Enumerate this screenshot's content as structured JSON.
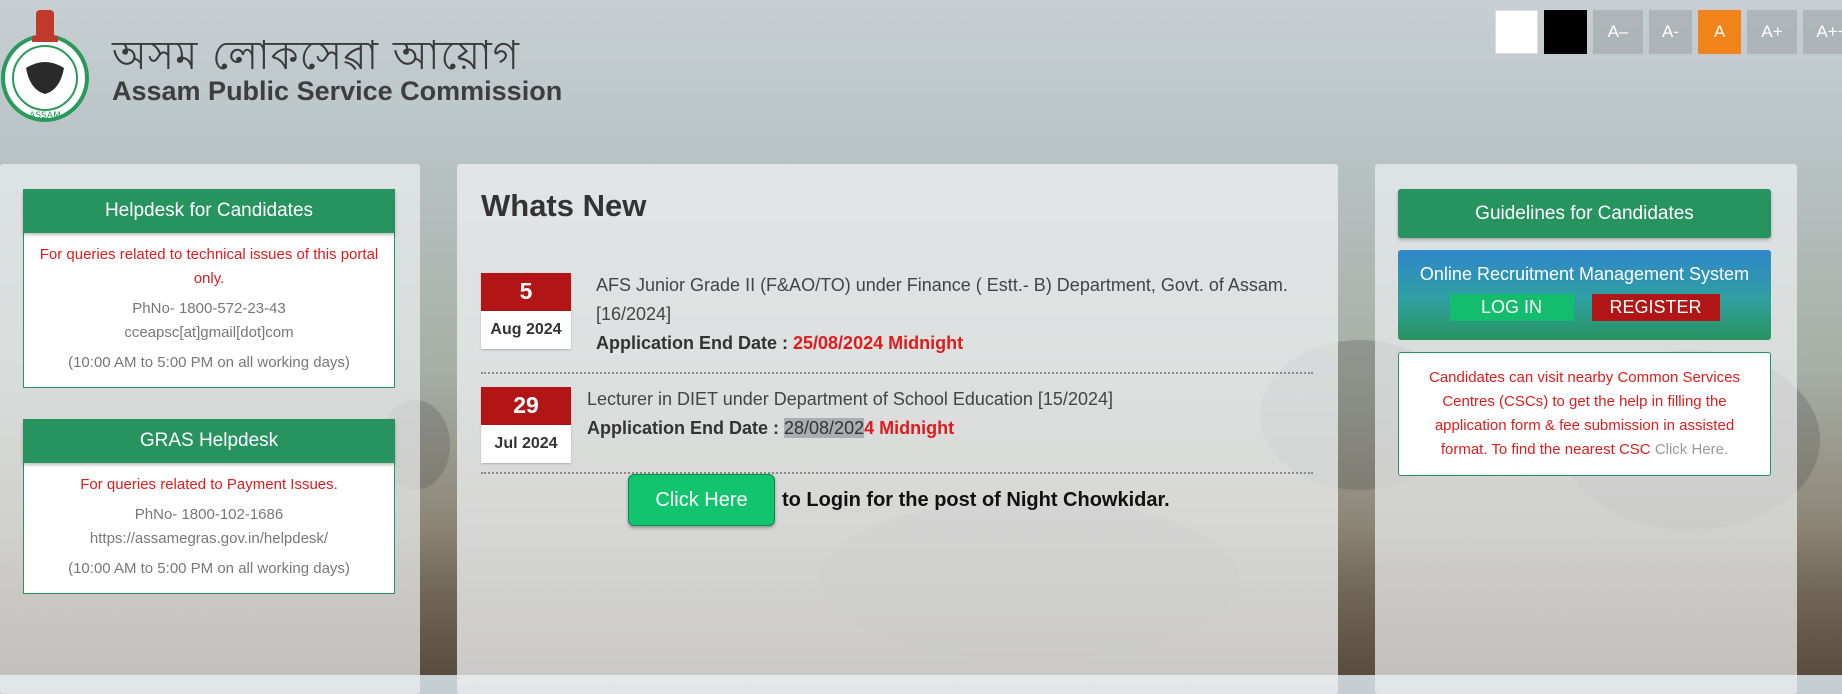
{
  "header": {
    "title_bn": "অসম লোকসেৱা আয়োগ",
    "title_en": "Assam Public Service Commission",
    "emblem_label": "ASSAM"
  },
  "font_tools": [
    "",
    "",
    "A–",
    "A-",
    "A",
    "A+",
    "A++"
  ],
  "helpdesk": {
    "title": "Helpdesk for Candidates",
    "note": "For queries related to technical issues of this portal only.",
    "phone": "PhNo- 1800-572-23-43",
    "email": "cceapsc[at]gmail[dot]com",
    "hours": "(10:00 AM to 5:00 PM on all working days)"
  },
  "gras": {
    "title": "GRAS Helpdesk",
    "note": "For queries related to Payment Issues.",
    "phone": "PhNo- 1800-102-1686",
    "url": "https://assamegras.gov.in/helpdesk/",
    "hours": "(10:00 AM to 5:00 PM on all working days)"
  },
  "whats_new": {
    "title": "Whats New",
    "items": [
      {
        "day": "5",
        "month": "Aug 2024",
        "text": "AFS Junior Grade II (F&AO/TO) under Finance ( Estt.- B) Department, Govt. of Assam. [16/2024]",
        "end_label": "Application End Date : ",
        "end_date": "25/08/2024 Midnight"
      },
      {
        "day": "29",
        "month": "Jul 2024",
        "text": "Lecturer in DIET under Department of School Education [15/2024]",
        "end_label": "Application End Date : ",
        "end_date_highlight": "28/08/202",
        "end_date_rest": "4 Midnight"
      }
    ],
    "click_here": "Click Here",
    "login_text": "to Login for the post of Night Chowkidar."
  },
  "right": {
    "guidelines": "Guidelines for Candidates",
    "orms_title": "Online Recruitment Management System",
    "login": "LOG IN",
    "register": "REGISTER",
    "csc_text": "Candidates can visit nearby Common Services Centres (CSCs) to get the help in filling the application form & fee submission in assisted format. To find the nearest CSC ",
    "csc_link": "Click Here."
  },
  "colors": {
    "green": "#27935f",
    "red": "#b11515",
    "accent_orange": "#f0831a",
    "alert_red": "#e01b1b"
  }
}
